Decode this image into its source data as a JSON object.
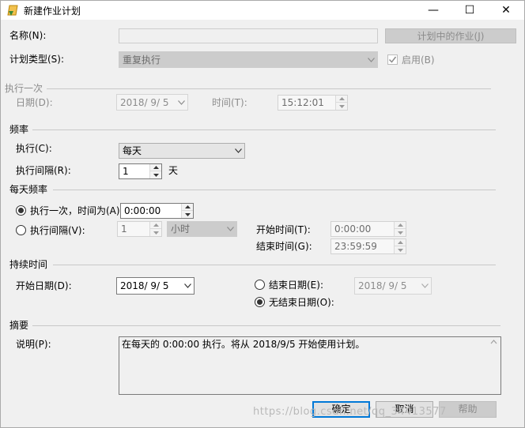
{
  "window": {
    "title": "新建作业计划",
    "minimize_glyph": "—",
    "maximize_glyph": "☐",
    "close_glyph": "✕"
  },
  "name": {
    "label": "名称(N):",
    "value": "",
    "jobs_button": "计划中的作业(J)"
  },
  "schedule_type": {
    "label": "计划类型(S):",
    "value": "重复执行",
    "enabled_label": "启用(B)",
    "enabled_checked": true
  },
  "one_time": {
    "header": "执行一次",
    "date_label": "日期(D):",
    "date_value": "2018/ 9/ 5",
    "time_label": "时间(T):",
    "time_value": "15:12:01"
  },
  "frequency": {
    "header": "频率",
    "occurs_label": "执行(C):",
    "occurs_value": "每天",
    "recurs_label": "执行间隔(R):",
    "recurs_value": "1",
    "recurs_unit": "天"
  },
  "daily_frequency": {
    "header": "每天频率",
    "once_label": "执行一次，时间为(A):",
    "once_value": "0:00:00",
    "once_selected": true,
    "every_label": "执行间隔(V):",
    "every_value": "1",
    "every_unit": "小时",
    "start_time_label": "开始时间(T):",
    "start_time_value": "0:00:00",
    "end_time_label": "结束时间(G):",
    "end_time_value": "23:59:59"
  },
  "duration": {
    "header": "持续时间",
    "start_date_label": "开始日期(D):",
    "start_date_value": "2018/ 9/ 5",
    "end_date_label": "结束日期(E):",
    "end_date_value": "2018/ 9/ 5",
    "no_end_label": "无结束日期(O):",
    "no_end_selected": true
  },
  "summary": {
    "header": "摘要",
    "desc_label": "说明(P):",
    "desc_value": "在每天的 0:00:00 执行。将从 2018/9/5 开始使用计划。"
  },
  "buttons": {
    "ok": "确定",
    "cancel": "取消",
    "help": "帮助"
  },
  "watermark": "https://blog.csdn.net/qq_34413577"
}
